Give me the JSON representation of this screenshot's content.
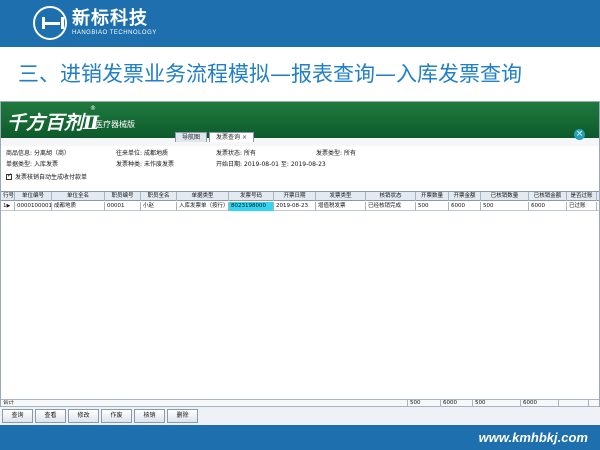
{
  "slide": {
    "logo_cn": "新标科技",
    "logo_en": "HANGBIAO TECHNOLOGY",
    "title": "三、进销发票业务流程模拟—报表查询—入库发票查询",
    "website": "www.kmhbkj.com"
  },
  "app": {
    "brand": "千方百剂Ⅱ",
    "brand_sub": "医疗器械版",
    "brand_reg": "®",
    "tabs": [
      "导航图",
      "发票查询"
    ],
    "tab_close": "×",
    "close_icon": "×"
  },
  "filters": {
    "product_label": "商品信息:",
    "product_value": "分离胡（商）",
    "counterparty_label": "往来单位:",
    "counterparty_value": "成都地质",
    "invoice_status_label": "发票状态:",
    "invoice_status_value": "所有",
    "invoice_type_label": "发票类型:",
    "invoice_type_value": "所有",
    "doc_type_label": "单据类型:",
    "doc_type_value": "入库发票",
    "invoice_kind_label": "发票种类:",
    "invoice_kind_value": "未作废发票",
    "start_date_label": "开始日期:",
    "start_date_value": "2019-08-01",
    "to_label": "至:",
    "end_date_value": "2019-08-23",
    "auto_generate_label": "发票核销自动生成收付款单"
  },
  "grid": {
    "columns": [
      "行号",
      "单位编号",
      "单位全名",
      "职员编号",
      "职员全名",
      "单据类型",
      "发票号码",
      "开票日期",
      "发票类型",
      "核销状态",
      "开票数量",
      "开票金额",
      "已核销数量",
      "已核销金额",
      "是否过账"
    ],
    "rows": [
      [
        "1",
        "0000100001",
        "成都地质",
        "00001",
        "小赵",
        "入库发票单（按行）",
        "8023198000",
        "2019-08-23",
        "增值税发票",
        "已经核销完成",
        "500",
        "6000",
        "500",
        "6000",
        "已过账"
      ]
    ],
    "footer": [
      "合计",
      "500",
      "6000",
      "500",
      "6000"
    ],
    "row_pointer_icon": "▶"
  },
  "toolbar": {
    "buttons": [
      "查询",
      "查看",
      "修改",
      "作废",
      "核销",
      "删除"
    ]
  },
  "colors": {
    "slide_blue": "#1d6fae",
    "title_blue": "#1f7fc8",
    "banner_green": "#1f7a3e",
    "highlight_cyan": "#33d6f0"
  }
}
